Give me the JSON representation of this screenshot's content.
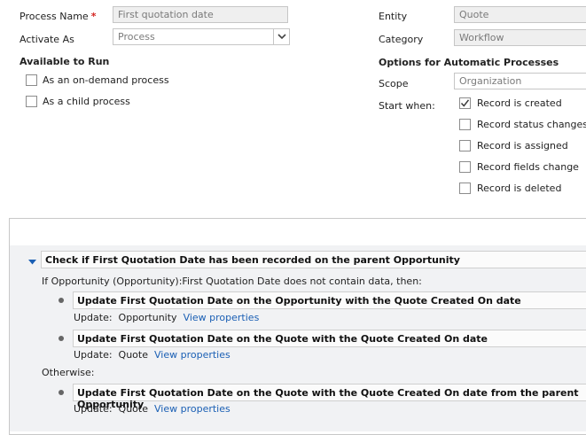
{
  "form": {
    "process_name_label": "Process Name",
    "required_mark": "*",
    "process_name_value": "First quotation date",
    "activate_as_label": "Activate As",
    "activate_as_value": "Process",
    "available_to_run_heading": "Available to Run",
    "on_demand_label": "As an on-demand process",
    "child_process_label": "As a child process",
    "entity_label": "Entity",
    "entity_value": "Quote",
    "category_label": "Category",
    "category_value": "Workflow",
    "options_heading": "Options for Automatic Processes",
    "scope_label": "Scope",
    "scope_value": "Organization",
    "start_when_label": "Start when:",
    "start_options": [
      {
        "label": "Record is created",
        "checked": true
      },
      {
        "label": "Record status changes",
        "checked": false
      },
      {
        "label": "Record is assigned",
        "checked": false
      },
      {
        "label": "Record fields change",
        "checked": false
      },
      {
        "label": "Record is deleted",
        "checked": false
      }
    ]
  },
  "steps": {
    "main_step": "Check if First Quotation Date has been recorded on the parent Opportunity",
    "condition": "If Opportunity (Opportunity):First Quotation Date does not contain data, then:",
    "if_steps": [
      {
        "title": "Update First Quotation Date on the Opportunity with the Quote Created On date",
        "update_label": "Update:",
        "entity": "Opportunity",
        "link": "View properties"
      },
      {
        "title": "Update First Quotation Date on the Quote with the Quote Created On date",
        "update_label": "Update:",
        "entity": "Quote",
        "link": "View properties"
      }
    ],
    "otherwise_label": "Otherwise:",
    "else_steps": [
      {
        "title": "Update First Quotation Date on the Quote with the Quote Created On date from the parent Opportunity",
        "update_label": "Update:",
        "entity": "Quote",
        "link": "View properties"
      }
    ]
  }
}
